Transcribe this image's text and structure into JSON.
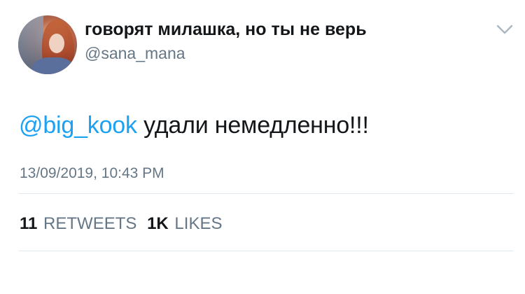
{
  "user": {
    "display_name": "говорят милашка, но ты не верь",
    "handle": "@sana_mana"
  },
  "tweet": {
    "mention": "@big_kook",
    "text": " удали немедленно!!!",
    "timestamp": "13/09/2019, 10:43 PM"
  },
  "stats": {
    "retweets_count": "11",
    "retweets_label": "RETWEETS",
    "likes_count": "1K",
    "likes_label": "LIKES"
  },
  "icons": {
    "menu": "chevron-down-icon",
    "avatar": "avatar"
  },
  "colors": {
    "mention": "#1da1f2",
    "secondary_text": "#657786",
    "divider": "#e1e8ed"
  }
}
